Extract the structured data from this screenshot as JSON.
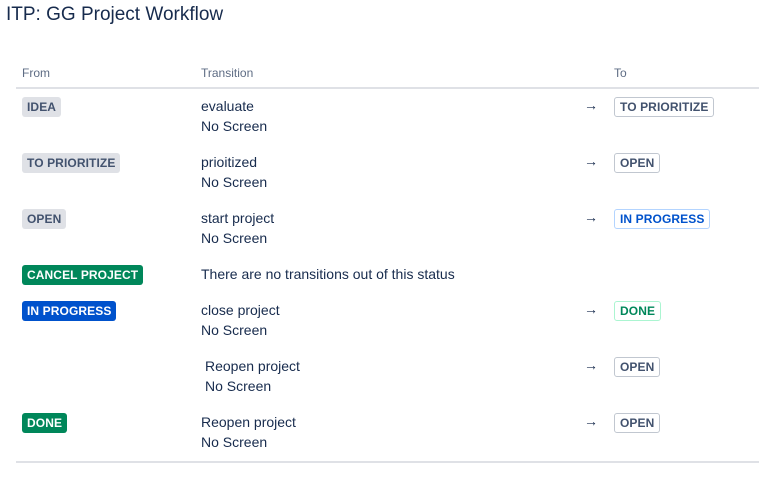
{
  "page": {
    "title": "ITP: GG Project Workflow"
  },
  "table": {
    "headers": {
      "from": "From",
      "transition": "Transition",
      "to": "To"
    },
    "arrow_glyph": "→",
    "rows": [
      {
        "from": "IDEA",
        "transition": "evaluate",
        "screen": "No Screen",
        "to": "TO PRIORITIZE"
      },
      {
        "from": "TO PRIORITIZE",
        "transition": "prioitized",
        "screen": "No Screen",
        "to": "OPEN"
      },
      {
        "from": "OPEN",
        "transition": "start project",
        "screen": "No Screen",
        "to": "IN PROGRESS"
      },
      {
        "from": "CANCEL PROJECT",
        "message": "There are no transitions out of this status"
      },
      {
        "from": "IN PROGRESS",
        "transition": "close project",
        "screen": "No Screen",
        "to": "DONE"
      },
      {
        "from": "",
        "transition": "Reopen project",
        "screen": "No Screen",
        "to": "OPEN"
      },
      {
        "from": "DONE",
        "transition": "Reopen project",
        "screen": "No Screen",
        "to": "OPEN"
      }
    ]
  },
  "colors": {
    "todo_grey": "#dfe1e6",
    "done_green": "#00875a",
    "inprogress_blue": "#0052cc",
    "text": "#172b4d",
    "muted": "#5e6c84"
  }
}
